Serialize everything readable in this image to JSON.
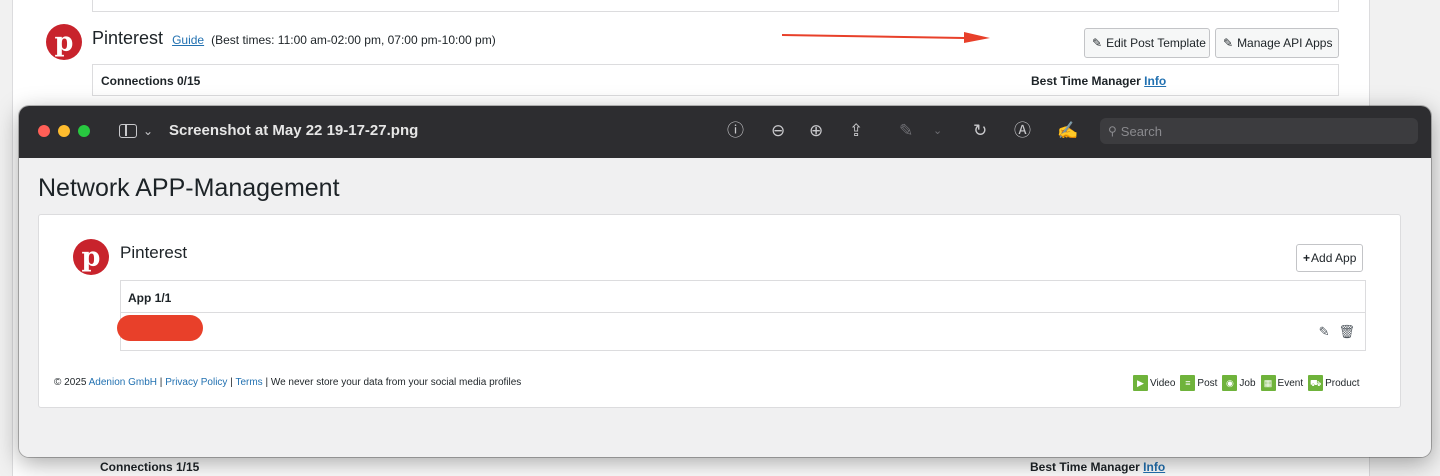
{
  "background": {
    "network": {
      "name": "Pinterest",
      "logo_letter": "p",
      "guide_link": "Guide",
      "best_times": "(Best times: 11:00 am-02:00 pm, 07:00 pm-10:00 pm)",
      "edit_template_button": "Edit Post Template",
      "manage_apps_button": "Manage API Apps",
      "connections": "Connections 0/15",
      "best_time_manager": "Best Time Manager",
      "info_link": "Info"
    },
    "bottom_row": {
      "connections": "Connections 1/15",
      "best_time_manager": "Best Time Manager",
      "info_link": "Info"
    },
    "colors": {
      "annotation_arrow": "#e8402a",
      "pinterest": "#c8232c"
    }
  },
  "preview_window": {
    "title": "Screenshot at May 22 19-17-27.png",
    "search_placeholder": "Search",
    "toolbar_icons": [
      "info-icon",
      "zoom-out-icon",
      "zoom-in-icon",
      "share-icon",
      "markup-pen-icon",
      "chevron-down-icon",
      "rotate-icon",
      "markup-icon",
      "signature-icon"
    ]
  },
  "content": {
    "page_title": "Network APP-Management",
    "network": {
      "name": "Pinterest",
      "logo_letter": "p",
      "add_app_button": "Add App",
      "table_header": "App 1/1",
      "redaction_color": "#e8402a"
    },
    "footer": {
      "copyright": "© 2025",
      "company_link": "Adenion GmbH",
      "sep1": "|",
      "privacy_link": "Privacy Policy",
      "sep2": "|",
      "terms_link": "Terms",
      "note": "| We never store your data from your social media profiles"
    },
    "post_types": [
      "Video",
      "Post",
      "Job",
      "Event",
      "Product"
    ]
  }
}
